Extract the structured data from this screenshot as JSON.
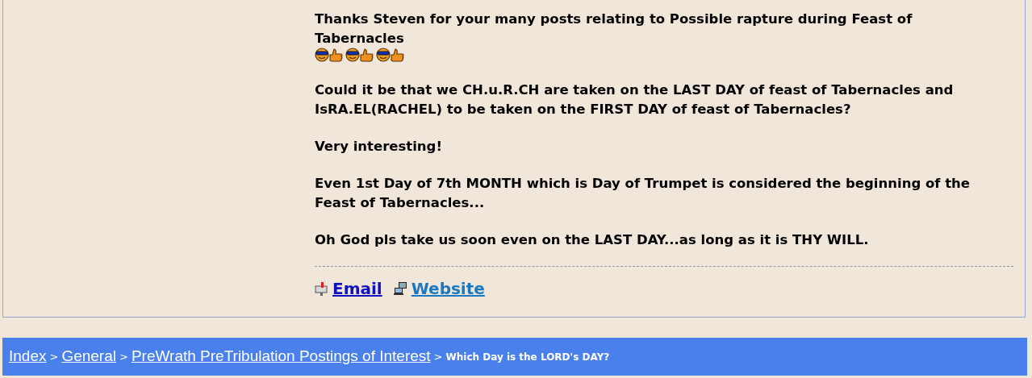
{
  "post": {
    "paragraphs": [
      {
        "text": "Thanks Steven for your many posts relating to Possible rapture during Feast of Tabernacles",
        "emoticons": [
          {
            "kind": "cool-thumbs-up"
          },
          {
            "kind": "cool-thumbs-up"
          },
          {
            "kind": "cool-thumbs-up"
          }
        ]
      },
      {
        "text": "Could it be that we CH.u.R.CH are taken on the LAST DAY of feast of Tabernacles and IsRA.EL(RACHEL) to be taken on the FIRST DAY of feast of Tabernacles?"
      },
      {
        "text": "Very interesting!"
      },
      {
        "text": "Even 1st Day of 7th MONTH which is Day of Trumpet is considered the beginning of the Feast of Tabernacles..."
      },
      {
        "text": "Oh God pls take us soon even on the LAST DAY...as long as it is THY WILL."
      }
    ],
    "links": [
      {
        "kind": "email",
        "label": "Email"
      },
      {
        "kind": "website",
        "label": "Website"
      }
    ]
  },
  "breadcrumb": {
    "links": [
      "Index",
      "General",
      "PreWrath PreTribulation Postings of Interest"
    ],
    "separators": [
      ">",
      ">",
      ">"
    ],
    "current": "Which Day is the LORD's DAY?"
  }
}
